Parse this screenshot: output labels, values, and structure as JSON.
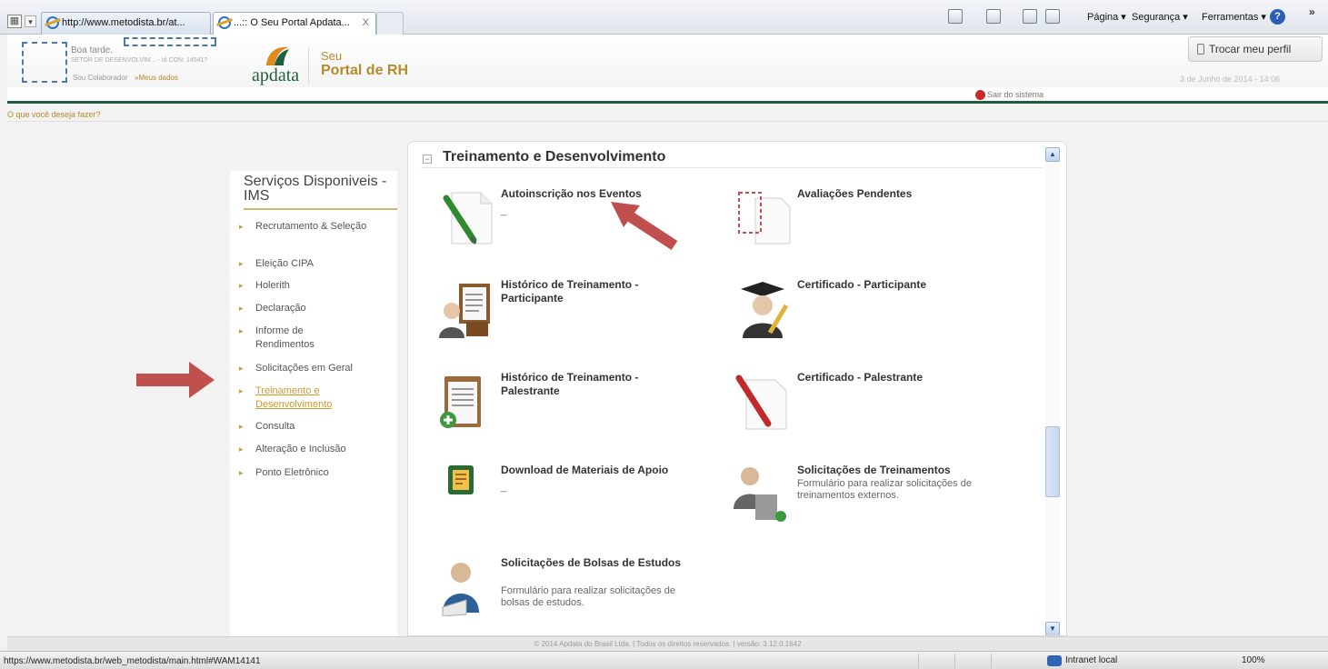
{
  "browser": {
    "tab1_title": "http://www.metodista.br/at...",
    "tab2_title": "...:: O Seu Portal Apdata...",
    "tab2_close": "X",
    "menu_pagina": "Página ▾",
    "menu_seguranca": "Segurança ▾",
    "menu_ferramentas": "Ferramentas ▾",
    "more": "»",
    "help": "?"
  },
  "header": {
    "greeting": "Boa tarde,",
    "sector": "SETOR DE DESENVOLVIM... - Id CON: 14541?",
    "role": "Sou Colaborador",
    "my_data": "»Meus dados",
    "logo": "apdata",
    "seu": "Seu",
    "portal": "Portal de RH",
    "switch_profile": "Trocar meu perfil",
    "datetime": "3 de Junho de 2014 - 14:06",
    "logout": "Sair do sistema",
    "what_to_do": "O que você deseja fazer?"
  },
  "sidebar": {
    "title": "Serviços Disponiveis - IMS",
    "items": [
      {
        "label": "Recrutamento & Seleção"
      },
      {
        "label": "Eleição CIPA"
      },
      {
        "label": "Holerith"
      },
      {
        "label": "Declaração"
      },
      {
        "label": "Informe de Rendimentos"
      },
      {
        "label": "Solicitações em Geral"
      },
      {
        "label": "Treinamento e Desenvolvimento"
      },
      {
        "label": "Consulta"
      },
      {
        "label": "Alteração e Inclusão"
      },
      {
        "label": "Ponto Eletrônico"
      }
    ]
  },
  "panel": {
    "title": "Treinamento e Desenvolvimento",
    "services": [
      {
        "title": "Autoinscrição nos Eventos",
        "desc": "_"
      },
      {
        "title": "Avaliações Pendentes",
        "desc": ""
      },
      {
        "title": "Histórico de Treinamento - Participante",
        "desc": ""
      },
      {
        "title": "Certificado - Participante",
        "desc": ""
      },
      {
        "title": "Histórico de Treinamento - Palestrante",
        "desc": ""
      },
      {
        "title": "Certificado - Palestrante",
        "desc": ""
      },
      {
        "title": "Download de Materiais de Apoio",
        "desc": "_"
      },
      {
        "title": "Solicitações de Treinamentos",
        "desc": "Formulário para realizar solicitações de treinamentos externos."
      },
      {
        "title": "Solicitações de Bolsas de Estudos",
        "desc": "Formulário para realizar solicitações de bolsas de estudos."
      }
    ]
  },
  "footer": "© 2014 Apdata do Brasil Ltda. | Todos os direitos reservados. | versão: 3.12.0.1642",
  "statusbar": {
    "url": "https://www.metodista.br/web_metodista/main.html#WAM14141",
    "zone": "Intranet local",
    "zoom": "100%"
  },
  "colors": {
    "accent_gold": "#b48a2a",
    "brand_green": "#1f5f3d",
    "arrow_red": "#c0504d"
  }
}
